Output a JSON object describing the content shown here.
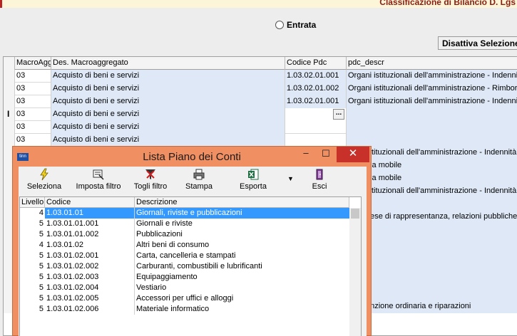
{
  "window": {
    "title": "Classificazione di Bilancio D. Lgs"
  },
  "radio": {
    "label": "Entrata"
  },
  "disable_button": {
    "label": "Disattiva Selezione"
  },
  "grid": {
    "columns": [
      "MacroAgg.",
      "Des. Macroaggregato",
      "Codice Pdc",
      "pdc_descr"
    ],
    "rows": [
      {
        "macro": "03",
        "des": "Acquisto di beni e servizi",
        "pdc": "1.03.02.01.001",
        "descr": "Organi istituzionali dell'amministrazione - Indennità"
      },
      {
        "macro": "03",
        "des": "Acquisto di beni e servizi",
        "pdc": "1.03.02.01.002",
        "descr": "Organi istituzionali dell'amministrazione - Rimborsi"
      },
      {
        "macro": "03",
        "des": "Acquisto di beni e servizi",
        "pdc": "1.03.02.01.001",
        "descr": "Organi istituzionali dell'amministrazione - Indennità"
      },
      {
        "macro": "03",
        "des": "Acquisto di beni e servizi",
        "pdc": "",
        "descr": ""
      },
      {
        "macro": "03",
        "des": "Acquisto di beni e servizi",
        "pdc": "",
        "descr": ""
      },
      {
        "macro": "03",
        "des": "Acquisto di beni e servizi",
        "pdc": "",
        "descr": ""
      }
    ],
    "partial_descr": [
      "istituzionali dell'amministrazione - Indennità",
      "nia mobile",
      "nia mobile",
      "istituzionali dell'amministrazione - Indennità",
      "",
      "pese di rappresentanza, relazioni pubbliche,",
      "",
      "",
      "",
      "",
      "",
      "",
      "enzione ordinaria e riparazioni"
    ]
  },
  "dialog": {
    "title": "Lista Piano dei Conti",
    "app_icon_text": "tinn",
    "toolbar": [
      {
        "label": "Seleziona",
        "icon": "lightning-icon"
      },
      {
        "label": "Imposta filtro",
        "icon": "filter-set-icon"
      },
      {
        "label": "Togli filtro",
        "icon": "filter-remove-icon"
      },
      {
        "label": "Stampa",
        "icon": "printer-icon"
      },
      {
        "label": "Esporta",
        "icon": "excel-export-icon"
      },
      {
        "label": "Esci",
        "icon": "exit-door-icon"
      }
    ],
    "list": {
      "columns": [
        "Livello",
        "Codice",
        "Descrizione"
      ],
      "rows": [
        {
          "livello": "4",
          "codice": "1.03.01.01",
          "descrizione": "Giornali, riviste e pubblicazioni"
        },
        {
          "livello": "5",
          "codice": "1.03.01.01.001",
          "descrizione": "Giornali e riviste"
        },
        {
          "livello": "5",
          "codice": "1.03.01.01.002",
          "descrizione": "Pubblicazioni"
        },
        {
          "livello": "4",
          "codice": "1.03.01.02",
          "descrizione": "Altri beni di consumo"
        },
        {
          "livello": "5",
          "codice": "1.03.01.02.001",
          "descrizione": "Carta, cancelleria e stampati"
        },
        {
          "livello": "5",
          "codice": "1.03.01.02.002",
          "descrizione": "Carburanti, combustibili e lubrificanti"
        },
        {
          "livello": "5",
          "codice": "1.03.01.02.003",
          "descrizione": "Equipaggiamento"
        },
        {
          "livello": "5",
          "codice": "1.03.01.02.004",
          "descrizione": "Vestiario"
        },
        {
          "livello": "5",
          "codice": "1.03.01.02.005",
          "descrizione": "Accessori per uffici e alloggi"
        },
        {
          "livello": "5",
          "codice": "1.03.01.02.006",
          "descrizione": "Materiale informatico"
        }
      ],
      "selected_index": 0
    }
  }
}
